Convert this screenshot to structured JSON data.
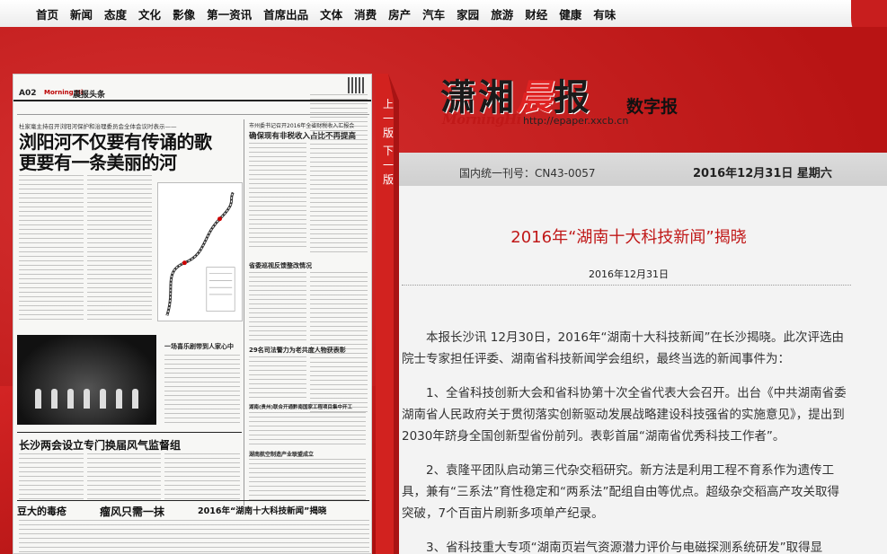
{
  "nav": {
    "items": [
      "首页",
      "新闻",
      "态度",
      "文化",
      "影像",
      "第一资讯",
      "首席出品",
      "文体",
      "消费",
      "房产",
      "汽车",
      "家园",
      "旅游",
      "财经",
      "健康",
      "有味"
    ]
  },
  "masthead": {
    "title_part1": "潇湘",
    "title_part2": "晨",
    "title_part3": "报",
    "english": "MorningHi",
    "url": "http://epaper.xxcb.cn",
    "digital_label": "数字报"
  },
  "issue": {
    "issn": "国内统一刊号：CN43-0057",
    "date": "2016年12月31日 星期六"
  },
  "page_nav": {
    "prev": "上一版",
    "next": "下一版"
  },
  "thumbnail": {
    "page_no": "A02",
    "brand": "Morning Hi",
    "section": "晨报头条",
    "lead_sub": "杜家毫主持召开浏阳河保护和治理委员会全体会议时表示——",
    "lead_line1": "浏阳河不仅要有传诵的歌",
    "lead_line2": "更要有一条美丽的河",
    "side_head": "确保现有非税收入占比不再提高",
    "side_kicker": "市州委书记召开2016年全省财税收入汇报会",
    "mid_head1": "省委巡视反馈整改情况",
    "mid_head2": "29名司法警力为老共度人物获表彰",
    "mid_head3": "湖南(贵州)联合开通黔南国家工程项目集中开工",
    "mid_head4": "湖南航空制造产业联盟成立",
    "sec_head": "长沙两会设立专门换届风气监督组",
    "photo_caption": "一场喜乐剧带到人家心中",
    "bottom1": "豆大的毒疮",
    "bottom2": "瘤风只需一抹",
    "bottom3": "2016年“湖南十大科技新闻”揭晓"
  },
  "article": {
    "title": "2016年“湖南十大科技新闻”揭晓",
    "date": "2016年12月31日",
    "paragraphs": [
      "本报长沙讯 12月30日，2016年“湖南十大科技新闻”在长沙揭晓。此次评选由院士专家担任评委、湖南省科技新闻学会组织，最终当选的新闻事件为：",
      "1、全省科技创新大会和省科协第十次全省代表大会召开。出台《中共湖南省委湖南省人民政府关于贯彻落实创新驱动发展战略建设科技强省的实施意见》，提出到2030年跻身全国创新型省份前列。表彰首届“湖南省优秀科技工作者”。",
      "2、袁隆平团队启动第三代杂交稻研究。新方法是利用工程不育系作为遗传工具，兼有“三系法”育性稳定和“两系法”配组自由等优点。超级杂交稻高产攻关取得突破，7个百亩片刷新多项单产纪录。",
      "3、省科技重大专项“湖南页岩气资源潜力评价与电磁探测系统研发”取得显"
    ]
  },
  "colors": {
    "brand_red": "#c81e1e",
    "title_red": "#c01818"
  }
}
